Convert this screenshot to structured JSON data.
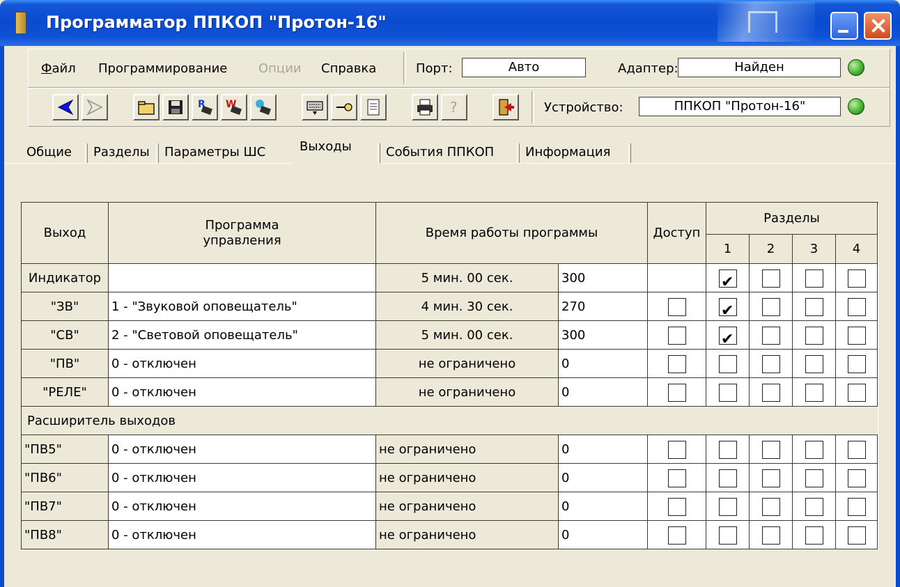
{
  "window": {
    "title": "Программатор ППКОП \"Протон-16\""
  },
  "menu": {
    "items": [
      {
        "label": "Файл",
        "enabled": true
      },
      {
        "label": "Программирование",
        "enabled": true
      },
      {
        "label": "Опции",
        "enabled": false
      },
      {
        "label": "Справка",
        "enabled": true
      }
    ],
    "port_label": "Порт:",
    "port_value": "Авто",
    "adapter_label": "Адаптер:",
    "adapter_value": "Найден",
    "adapter_led_color": "#3fae2a"
  },
  "toolbar": {
    "buttons": [
      "back-icon",
      "forward-icon",
      "open-folder-icon",
      "save-icon",
      "read-chip-icon",
      "write-chip-icon",
      "verify-chip-icon",
      "keyboard-icon",
      "key-icon",
      "notes-icon",
      "print-icon",
      "help-icon",
      "exit-icon"
    ],
    "device_label": "Устройство:",
    "device_value": "ППКОП \"Протон-16\"",
    "device_led_color": "#3fae2a"
  },
  "tabs": [
    {
      "label": "Общие",
      "active": false
    },
    {
      "label": "Разделы",
      "active": false
    },
    {
      "label": "Параметры ШС",
      "active": false
    },
    {
      "label": "Выходы",
      "active": true
    },
    {
      "label": "События ППКОП",
      "active": false
    },
    {
      "label": "Информация",
      "active": false
    }
  ],
  "grid": {
    "headers": {
      "output": "Выход",
      "program_line1": "Программа",
      "program_line2": "управления",
      "runtime": "Время работы программы",
      "access": "Доступ",
      "sections": "Разделы",
      "section_numbers": [
        "1",
        "2",
        "3",
        "4"
      ]
    },
    "rows": [
      {
        "output": "Индикатор",
        "program": "",
        "time": "5 мин. 00 сек.",
        "seconds": "300",
        "access": null,
        "sections": [
          true,
          false,
          false,
          false
        ]
      },
      {
        "output": "\"ЗВ\"",
        "program": "1 - \"Звуковой оповещатель\"",
        "time": "4 мин. 30 сек.",
        "seconds": "270",
        "access": false,
        "sections": [
          true,
          false,
          false,
          false
        ]
      },
      {
        "output": "\"СВ\"",
        "program": "2 - \"Световой оповещатель\"",
        "time": "5 мин. 00 сек.",
        "seconds": "300",
        "access": false,
        "sections": [
          true,
          false,
          false,
          false
        ]
      },
      {
        "output": "\"ПВ\"",
        "program": "0 - отключен",
        "time": "не ограничено",
        "seconds": "0",
        "access": false,
        "sections": [
          false,
          false,
          false,
          false
        ]
      },
      {
        "output": "\"РЕЛЕ\"",
        "program": "0 - отключен",
        "time": "не ограничено",
        "seconds": "0",
        "access": false,
        "sections": [
          false,
          false,
          false,
          false
        ]
      }
    ],
    "expander_label": "Расширитель выходов",
    "ext_rows": [
      {
        "output": "\"ПВ5\"",
        "program": "0 - отключен",
        "time": "не ограничено",
        "seconds": "0",
        "access": false,
        "sections": [
          false,
          false,
          false,
          false
        ]
      },
      {
        "output": "\"ПВ6\"",
        "program": "0 - отключен",
        "time": "не ограничено",
        "seconds": "0",
        "access": false,
        "sections": [
          false,
          false,
          false,
          false
        ]
      },
      {
        "output": "\"ПВ7\"",
        "program": "0 - отключен",
        "time": "не ограничено",
        "seconds": "0",
        "access": false,
        "sections": [
          false,
          false,
          false,
          false
        ]
      },
      {
        "output": "\"ПВ8\"",
        "program": "0 - отключен",
        "time": "не ограничено",
        "seconds": "0",
        "access": false,
        "sections": [
          false,
          false,
          false,
          false
        ]
      }
    ]
  }
}
